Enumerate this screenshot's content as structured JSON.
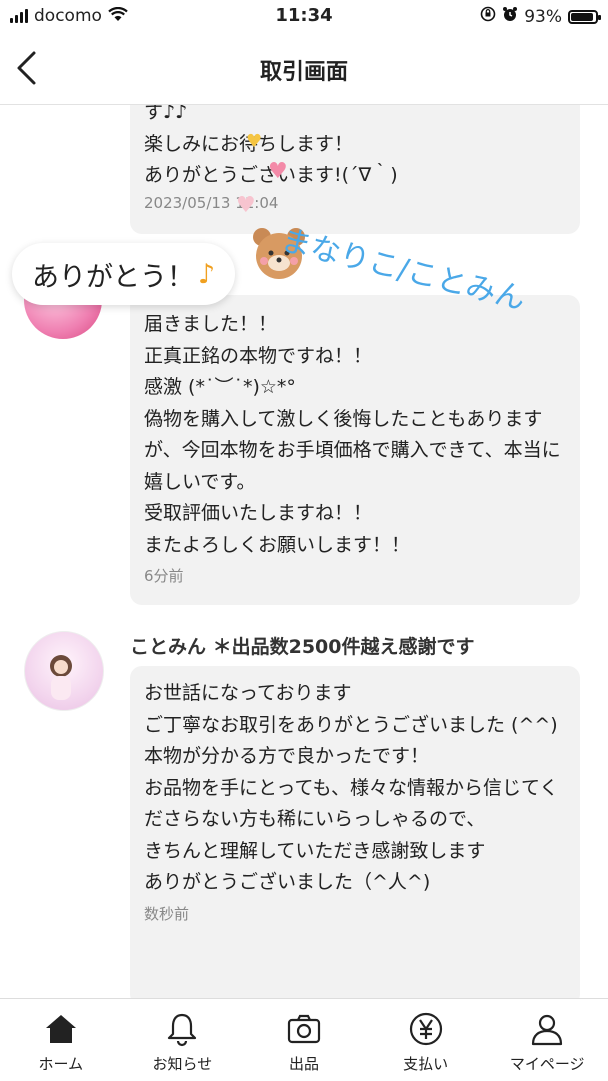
{
  "status": {
    "carrier": "docomo",
    "time": "11:34",
    "battery": "93%"
  },
  "header": {
    "back_icon": "chevron-left-icon",
    "title": "取引画面"
  },
  "overlay": {
    "thanks_sticker": "ありがとう！",
    "note_glyph": "♪",
    "handwriting": "まなりこ/ことみん"
  },
  "messages": [
    {
      "body": "す♪♪\n楽しみにお待ちします！\nありがとうございます!(´∇｀)",
      "time": "2023/05/13 11:04"
    },
    {
      "body": "届きました！！\n正真正銘の本物ですね！！\n感激 (*˙︶˙*)☆*°\n偽物を購入して激しく後悔したこともありますが、今回本物をお手頃価格で購入できて、本当に嬉しいです。\n受取評価いたしますね！！\nまたよろしくお願いします！！",
      "time": "6分前"
    },
    {
      "sender": "ことみん ＊出品数2500件越え感謝です",
      "body": "お世話になっております\nご丁寧なお取引をありがとうございました (^^)\n本物が分かる方で良かったです！\nお品物を手にとっても、様々な情報から信じてくださらない方も稀にいらっしゃるので、\nきちんと理解していただき感謝致します\nありがとうございました（^人^)",
      "time": "数秒前"
    }
  ],
  "tabs": [
    {
      "label": "ホーム",
      "icon": "home-icon"
    },
    {
      "label": "お知らせ",
      "icon": "bell-icon"
    },
    {
      "label": "出品",
      "icon": "camera-icon"
    },
    {
      "label": "支払い",
      "icon": "yen-icon"
    },
    {
      "label": "マイページ",
      "icon": "person-icon"
    }
  ]
}
